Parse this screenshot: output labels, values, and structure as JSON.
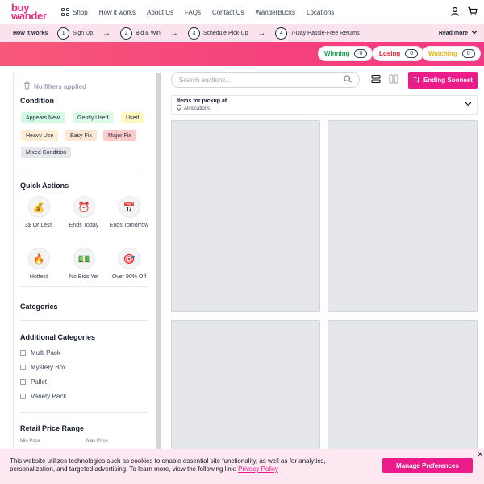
{
  "nav": {
    "logo_line1": "buy",
    "logo_line2": "wander",
    "shop": "Shop",
    "links": [
      "How it works",
      "About Us",
      "FAQs",
      "Contact Us",
      "WanderBucks",
      "Locations"
    ],
    "icons": [
      "user-icon",
      "cart-icon"
    ]
  },
  "how": {
    "title": "How it works",
    "steps": [
      {
        "num": "1",
        "label": "Sign Up"
      },
      {
        "num": "2",
        "label": "Bid & Win"
      },
      {
        "num": "3",
        "label": "Schedule Pick-Up"
      },
      {
        "num": "4",
        "label": "7-Day Hassle-Free Returns"
      }
    ],
    "read_more": "Read more"
  },
  "status": {
    "winning": {
      "label": "Winning",
      "count": "0",
      "color": "#16a34a"
    },
    "losing": {
      "label": "Losing",
      "count": "0",
      "color": "#dc2626"
    },
    "watching": {
      "label": "Watching",
      "count": "0",
      "color": "#eab308"
    }
  },
  "filters": {
    "no_filters": "No filters applied",
    "condition_title": "Condition",
    "conditions": [
      {
        "label": "Appears New",
        "bg": "#d1fae5"
      },
      {
        "label": "Gently Used",
        "bg": "#dcfce7"
      },
      {
        "label": "Used",
        "bg": "#fef9c3"
      },
      {
        "label": "Heavy Use",
        "bg": "#ffedd5"
      },
      {
        "label": "Easy Fix",
        "bg": "#fde6d2"
      },
      {
        "label": "Major Fix",
        "bg": "#fecaca"
      },
      {
        "label": "Mixed Condition",
        "bg": "#e5e7eb"
      }
    ],
    "quick_title": "Quick Actions",
    "quick": [
      {
        "icon": "💰",
        "label": "3$ Or Less"
      },
      {
        "icon": "⏰",
        "label": "Ends Today"
      },
      {
        "icon": "📅",
        "label": "Ends Tomorrow"
      },
      {
        "icon": "🔥",
        "label": "Hottest"
      },
      {
        "icon": "💵",
        "label": "No Bids Yet"
      },
      {
        "icon": "🎯",
        "label": "Over 90% Off"
      }
    ],
    "categories_title": "Categories",
    "additional_title": "Additional Categories",
    "additional": [
      "Multi Pack",
      "Mystery Box",
      "Pallet",
      "Variety Pack"
    ],
    "price_title": "Retail Price Range",
    "min_price": "Min Price",
    "max_price": "Max Price"
  },
  "main": {
    "search_placeholder": "Search auctions...",
    "sort_label": "Ending Soonest",
    "pickup_title": "Items for pickup at",
    "pickup_location": "All locations"
  },
  "cookie": {
    "text": "This website utilizes technologies such as cookies to enable essential site functionality, as well as for analytics, personalization, and targeted advertising. To learn more, view the following link:",
    "link": "Privacy Policy",
    "button": "Manage Preferences",
    "close": "✕"
  }
}
